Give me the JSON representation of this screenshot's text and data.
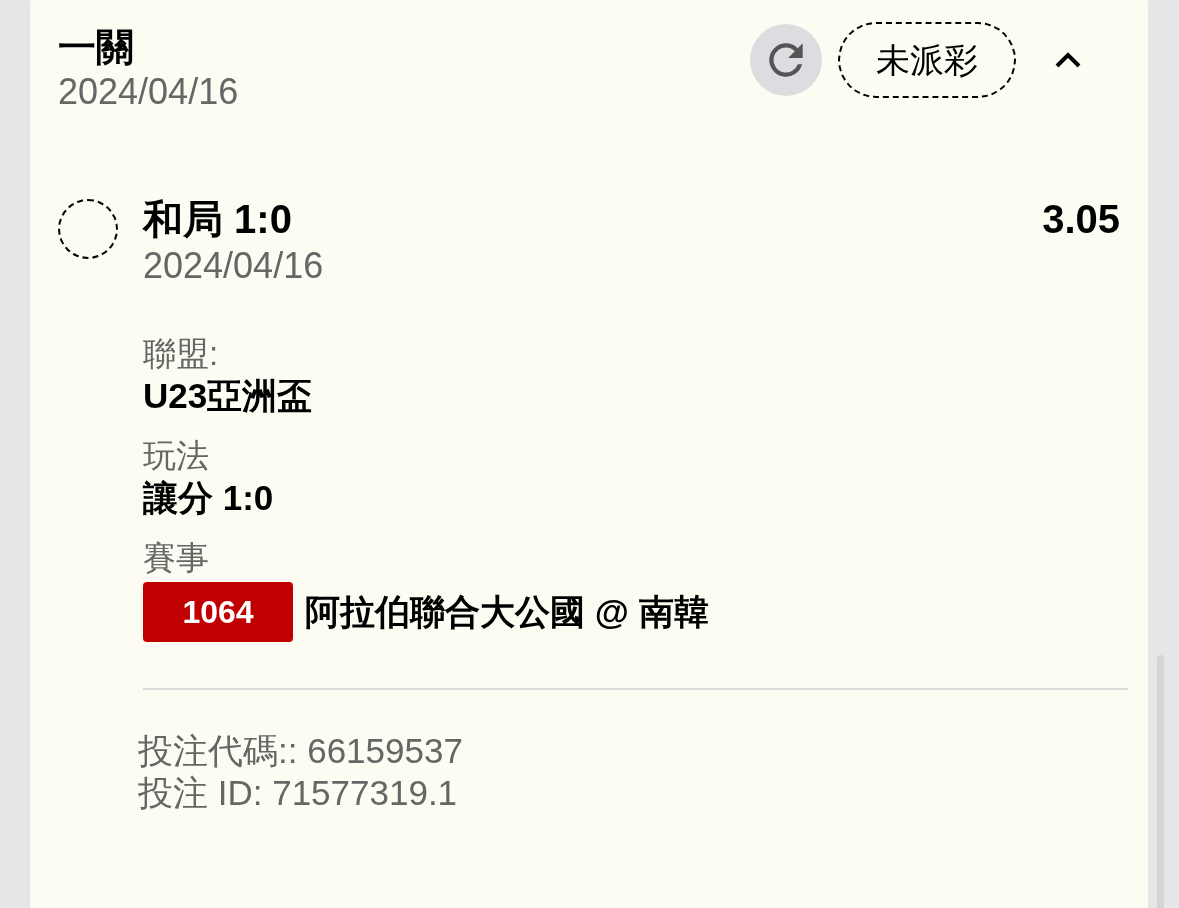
{
  "bet": {
    "title": "一關",
    "date": "2024/04/16",
    "status": "未派彩",
    "expanded": true
  },
  "selection": {
    "name": "和局 1:0",
    "date": "2024/04/16",
    "odds": "3.05",
    "settled": false
  },
  "details": [
    {
      "kind": "text",
      "label": "聯盟:",
      "value": "U23亞洲盃"
    },
    {
      "kind": "text",
      "label": "玩法",
      "value": "讓分 1:0"
    },
    {
      "kind": "match",
      "label": "賽事",
      "match_number": "1064",
      "value": "阿拉伯聯合大公國 @ 南韓"
    }
  ],
  "footer": [
    "投注代碼:: 66159537",
    "投注 ID: 71577319.1"
  ]
}
